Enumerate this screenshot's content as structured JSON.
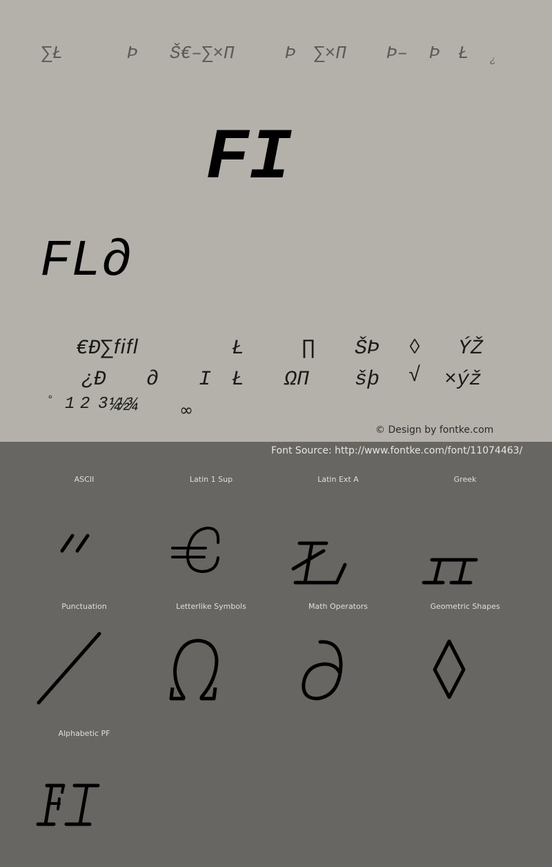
{
  "preview": {
    "header_glyphs": [
      {
        "text": "∑Ł"
      },
      {
        "text": "Þ"
      },
      {
        "text": "Š€–∑×Π"
      },
      {
        "text": "Þ"
      },
      {
        "text": "∑×Π"
      },
      {
        "text": "Þ–"
      },
      {
        "text": "Þ"
      },
      {
        "text": "Ł"
      },
      {
        "text": "¿"
      }
    ],
    "sample_large": "FI",
    "sample_medium": "FL∂",
    "charset_rows": [
      [
        "€Ð∑ﬁﬂ",
        "Ł",
        "∏",
        "ŠÞ",
        "◊",
        "ÝŽ"
      ],
      [
        "¿Ð",
        "∂",
        "I",
        "Ł",
        "ΩΠ",
        "šþ",
        "√",
        "×ýž"
      ],
      [
        "°",
        "1",
        "2",
        "3",
        "¼½¾",
        "∞"
      ]
    ]
  },
  "credit": "© Design by fontke.com",
  "source": "Font Source: http://www.fontke.com/font/11074463/",
  "colors": {
    "top_background": "#b4b1aa",
    "bottom_background": "#676662",
    "glyph": "#000000"
  },
  "blocks": [
    {
      "label": "ASCII",
      "glyph": "\"",
      "icon": "double-quote-glyph"
    },
    {
      "label": "Latin 1 Sup",
      "glyph": "€",
      "icon": "euro-glyph"
    },
    {
      "label": "Latin Ext A",
      "glyph": "Ł",
      "icon": "l-stroke-glyph"
    },
    {
      "label": "Greek",
      "glyph": "Π",
      "icon": "pi-glyph"
    },
    {
      "label": "Punctuation",
      "glyph": "⁄",
      "icon": "fraction-slash-glyph"
    },
    {
      "label": "Letterlike Symbols",
      "glyph": "Ω",
      "icon": "omega-glyph"
    },
    {
      "label": "Math Operators",
      "glyph": "∂",
      "icon": "partial-glyph"
    },
    {
      "label": "Geometric Shapes",
      "glyph": "◊",
      "icon": "lozenge-glyph"
    },
    {
      "label": "Alphabetic PF",
      "glyph": "FI",
      "icon": "fi-ligature-glyph"
    }
  ]
}
